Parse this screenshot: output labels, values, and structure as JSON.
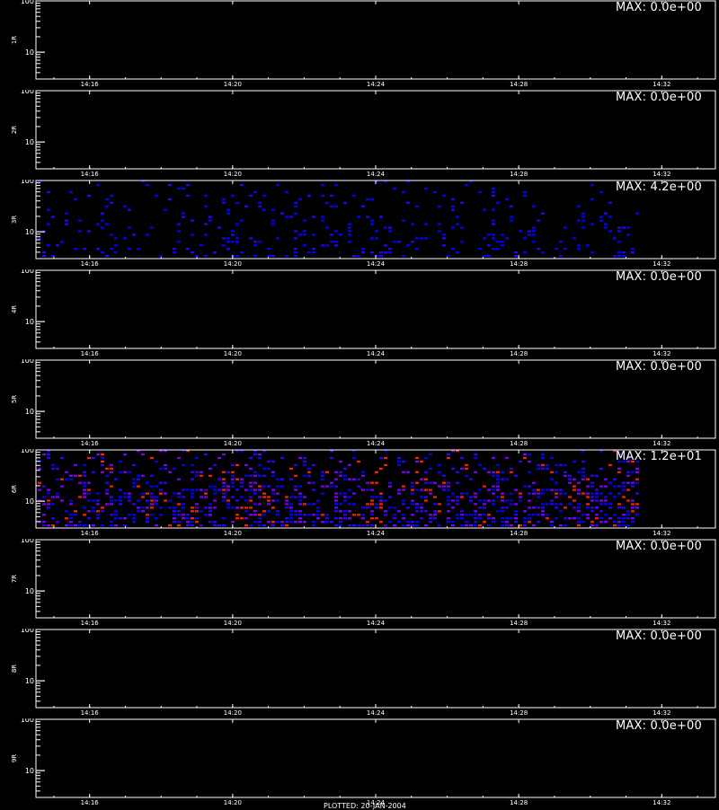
{
  "chart_data": {
    "type": "heatmap",
    "ylim": [
      3,
      100
    ],
    "yscale": "log",
    "y_tick_labels": [
      "100",
      "10"
    ],
    "x_tick_labels": [
      "14:16",
      "14:20",
      "14:24",
      "14:28",
      "14:32"
    ],
    "x_range_minutes": [
      14.5,
      33.5
    ],
    "panels": [
      {
        "ylabel": "1R",
        "max_label": "MAX: 0.0e+00",
        "max": 0.0,
        "has_data": false
      },
      {
        "ylabel": "2R",
        "max_label": "MAX: 0.0e+00",
        "max": 0.0,
        "has_data": false
      },
      {
        "ylabel": "3R",
        "max_label": "MAX: 4.2e+00",
        "max": 4.2,
        "has_data": true,
        "density": 0.13,
        "data_end": "14:31"
      },
      {
        "ylabel": "4R",
        "max_label": "MAX: 0.0e+00",
        "max": 0.0,
        "has_data": false
      },
      {
        "ylabel": "5R",
        "max_label": "MAX: 0.0e+00",
        "max": 0.0,
        "has_data": false
      },
      {
        "ylabel": "6R",
        "max_label": "MAX: 1.2e+01",
        "max": 12.0,
        "has_data": true,
        "density": 0.42,
        "data_end": "14:31"
      },
      {
        "ylabel": "7R",
        "max_label": "MAX: 0.0e+00",
        "max": 0.0,
        "has_data": false
      },
      {
        "ylabel": "8R",
        "max_label": "MAX: 0.0e+00",
        "max": 0.0,
        "has_data": false
      },
      {
        "ylabel": "9R",
        "max_label": "MAX: 0.0e+00",
        "max": 0.0,
        "has_data": false
      }
    ],
    "colors": {
      "background": "#000000",
      "axis": "#ffffff",
      "low": "#0000ff",
      "mid": "#7a00ff",
      "high": "#ff2200"
    }
  },
  "footer": "PLOTTED: 20-JAN-2004"
}
